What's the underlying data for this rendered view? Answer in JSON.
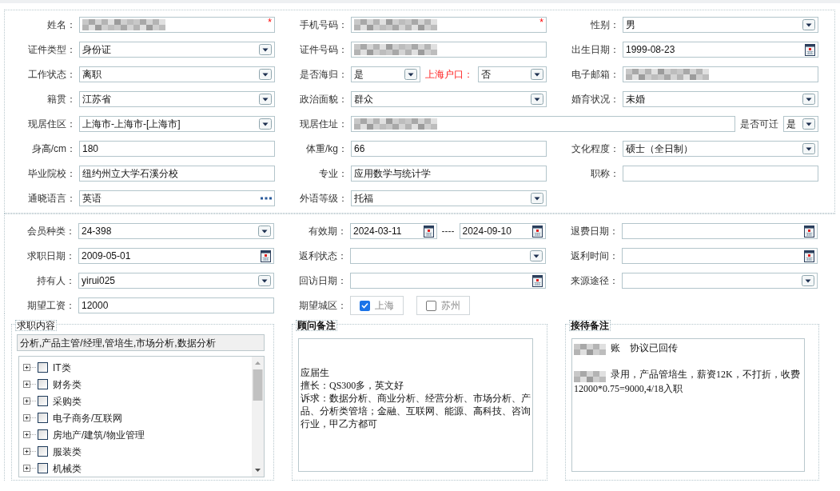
{
  "sections": [
    {
      "rows": [
        {
          "cells": [
            {
              "label": "姓名：",
              "controls": [
                {
                  "kind": "text",
                  "redacted": true,
                  "marker": "*"
                }
              ]
            },
            {
              "label": "手机号码：",
              "controls": [
                {
                  "kind": "text",
                  "redacted": true,
                  "marker": "*"
                }
              ]
            },
            {
              "label": "性别：",
              "controls": [
                {
                  "kind": "select",
                  "value": "男"
                }
              ]
            }
          ]
        },
        {
          "cells": [
            {
              "label": "证件类型：",
              "controls": [
                {
                  "kind": "select",
                  "value": "身份证"
                }
              ]
            },
            {
              "label": "证件号码：",
              "controls": [
                {
                  "kind": "text",
                  "redacted": true
                }
              ]
            },
            {
              "label": "出生日期：",
              "controls": [
                {
                  "kind": "date",
                  "value": "1999-08-23"
                }
              ]
            }
          ]
        },
        {
          "cells": [
            {
              "label": "工作状态：",
              "controls": [
                {
                  "kind": "select",
                  "value": "离职"
                }
              ]
            },
            {
              "label": "是否海归：",
              "controls": [
                {
                  "kind": "select",
                  "value": "是"
                },
                {
                  "kind": "label",
                  "text": "上海户口：",
                  "alert": true
                },
                {
                  "kind": "select",
                  "value": "否"
                }
              ]
            },
            {
              "label": "电子邮箱：",
              "controls": [
                {
                  "kind": "text",
                  "redacted": true
                }
              ]
            }
          ]
        },
        {
          "cells": [
            {
              "label": "籍贯：",
              "controls": [
                {
                  "kind": "select",
                  "value": "江苏省"
                }
              ]
            },
            {
              "label": "政治面貌：",
              "controls": [
                {
                  "kind": "select",
                  "value": "群众"
                }
              ]
            },
            {
              "label": "婚育状况：",
              "controls": [
                {
                  "kind": "select",
                  "value": "未婚"
                }
              ]
            }
          ]
        },
        {
          "cells": [
            {
              "label": "现居住区：",
              "controls": [
                {
                  "kind": "select",
                  "value": " 上海市-上海市-[上海市]"
                }
              ]
            },
            {
              "label": "现居住址：",
              "wide": true,
              "controls": [
                {
                  "kind": "text",
                  "redacted": true
                },
                {
                  "kind": "label",
                  "text": "是否可迁",
                  "alert": false
                },
                {
                  "kind": "mini-select",
                  "value": "是"
                }
              ]
            }
          ]
        },
        {
          "cells": [
            {
              "label": "身高/cm：",
              "controls": [
                {
                  "kind": "text",
                  "value": "180"
                }
              ]
            },
            {
              "label": "体重/kg：",
              "controls": [
                {
                  "kind": "text",
                  "value": "66"
                }
              ]
            },
            {
              "label": "文化程度：",
              "controls": [
                {
                  "kind": "select",
                  "value": "硕士（全日制）"
                }
              ]
            }
          ]
        },
        {
          "cells": [
            {
              "label": "毕业院校：",
              "controls": [
                {
                  "kind": "text",
                  "value": "纽约州立大学石溪分校"
                }
              ]
            },
            {
              "label": "专业：",
              "controls": [
                {
                  "kind": "text",
                  "value": "应用数学与统计学"
                }
              ]
            },
            {
              "label": "职称：",
              "controls": [
                {
                  "kind": "text"
                }
              ]
            }
          ]
        },
        {
          "cells": [
            {
              "label": "通晓语言：",
              "controls": [
                {
                  "kind": "lookup",
                  "value": "英语"
                }
              ]
            },
            {
              "label": "外语等级：",
              "controls": [
                {
                  "kind": "select",
                  "value": "托福"
                }
              ]
            }
          ]
        }
      ]
    },
    {
      "rows": [
        {
          "cells": [
            {
              "label": "会员种类：",
              "controls": [
                {
                  "kind": "select",
                  "value": " 24-398"
                }
              ]
            },
            {
              "label": "有效期：",
              "controls": [
                {
                  "kind": "date",
                  "value": "2024-03-11"
                },
                {
                  "kind": "label",
                  "text": "----",
                  "alert": false
                },
                {
                  "kind": "date",
                  "value": "2024-09-10"
                }
              ]
            },
            {
              "label": "退费日期：",
              "controls": [
                {
                  "kind": "date"
                }
              ]
            }
          ]
        },
        {
          "cells": [
            {
              "label": "求职日期：",
              "controls": [
                {
                  "kind": "date",
                  "value": "2009-05-01"
                }
              ]
            },
            {
              "label": "返利状态：",
              "controls": [
                {
                  "kind": "select"
                }
              ]
            },
            {
              "label": "返利时间：",
              "controls": [
                {
                  "kind": "date"
                }
              ]
            }
          ]
        },
        {
          "cells": [
            {
              "label": "持有人：",
              "controls": [
                {
                  "kind": "select",
                  "value": "yirui025"
                }
              ]
            },
            {
              "label": "回访日期：",
              "controls": [
                {
                  "kind": "date"
                }
              ]
            },
            {
              "label": "来源途径：",
              "controls": [
                {
                  "kind": "select"
                }
              ]
            }
          ]
        },
        {
          "cells": [
            {
              "label": "期望工资：",
              "controls": [
                {
                  "kind": "text",
                  "value": "12000"
                }
              ]
            },
            {
              "label": "期望城区：",
              "controls": [
                {
                  "kind": "checkbutton",
                  "text": "上海",
                  "checked": true
                },
                {
                  "kind": "checkbutton",
                  "text": "苏州",
                  "checked": false
                }
              ]
            }
          ]
        }
      ]
    }
  ],
  "job_panel": {
    "legend": "求职内容",
    "summary": "分析,产品主管/经理,管培生,市场分析,数据分析",
    "tree": [
      {
        "label": "IT类",
        "checked": false,
        "expanded": false
      },
      {
        "label": "财务类",
        "checked": false,
        "expanded": false
      },
      {
        "label": "采购类",
        "checked": false,
        "expanded": false
      },
      {
        "label": "电子商务/互联网",
        "checked": false,
        "expanded": false
      },
      {
        "label": "房地产/建筑/物业管理",
        "checked": false,
        "expanded": false
      },
      {
        "label": "服装类",
        "checked": false,
        "expanded": false
      },
      {
        "label": "机械类",
        "checked": false,
        "expanded": false
      }
    ]
  },
  "notes": [
    {
      "legend": "顾问备注",
      "paragraphs": [
        {
          "lines": [
            {
              "redacted": false,
              "text": "应届生"
            },
            {
              "redacted": false,
              "text": "擅长：QS300多，英文好"
            },
            {
              "redacted": false,
              "text": "诉求：数据分析、商业分析、经营分析、市场分析、产品、分析类管培；金融、互联网、能源、高科技、咨询行业，甲乙方都可"
            }
          ]
        }
      ]
    },
    {
      "legend": "接待备注",
      "paragraphs": [
        {
          "lines": [
            {
              "redacted": true,
              "text": "账    协议已回传"
            }
          ]
        },
        {
          "lines": [
            {
              "redacted": true,
              "text": "录用，产品管培生，薪资12K，不打折，收费"
            },
            {
              "redacted": false,
              "text": "12000*0.75=9000,4/18入职"
            }
          ]
        }
      ]
    }
  ]
}
